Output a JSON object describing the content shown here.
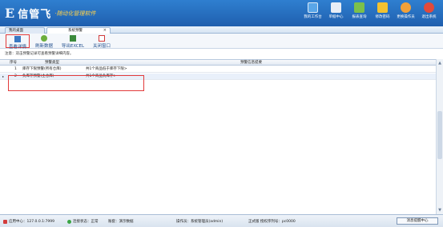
{
  "header": {
    "logo_mark": "E",
    "logo_name": "信管飞",
    "logo_sub": "·随动化管理软件",
    "nav": [
      {
        "label": "我的工作台",
        "icon": "monitor-icon",
        "color": "#5aa6e8"
      },
      {
        "label": "单据中心",
        "icon": "documents-icon",
        "color": "#e8eef6"
      },
      {
        "label": "报表查询",
        "icon": "report-icon",
        "color": "#7cc04b"
      },
      {
        "label": "修改密码",
        "icon": "lock-icon",
        "color": "#f2c230"
      },
      {
        "label": "更换操作员",
        "icon": "user-icon",
        "color": "#f2a13a"
      },
      {
        "label": "退出系统",
        "icon": "exit-icon",
        "color": "#e24a3b"
      }
    ]
  },
  "tabs": [
    {
      "label": "我的桌面"
    },
    {
      "label": "系统预警",
      "close": "×"
    }
  ],
  "toolbar": {
    "buttons": [
      {
        "label": "查看详情",
        "icon": "view-details-icon",
        "color": "#3a78c2"
      },
      {
        "label": "刷新数据",
        "icon": "refresh-icon",
        "color": "#6cae3d"
      },
      {
        "label": "导出EXCEL",
        "icon": "excel-icon",
        "color": "#3b8a3b"
      },
      {
        "label": "关闭窗口",
        "icon": "close-window-icon",
        "color": "#d23b3b"
      }
    ]
  },
  "note": "注意：双击预警记录可查看预警详细内容。",
  "grid": {
    "headers": [
      "序号",
      "预警类型",
      "预警信息提要"
    ],
    "rows": [
      {
        "no": "1",
        "type": "库存下限预警(所有仓库)",
        "summary": "共1个商品低于库存下限>"
      },
      {
        "no": "2",
        "type": "负库存预警(主仓库)",
        "summary": "共1个商品负库存>"
      }
    ],
    "selected_marker": "▸"
  },
  "statusbar": {
    "app_center": "应用中心：127.0.0.1:7999",
    "connection": "连接状态：正常",
    "account": "账套：演示数据",
    "operator": "操作员：系统管理员(admin)",
    "version": "正式版 授权序列号：pc0000",
    "msg_center": "消息提醒中心"
  }
}
